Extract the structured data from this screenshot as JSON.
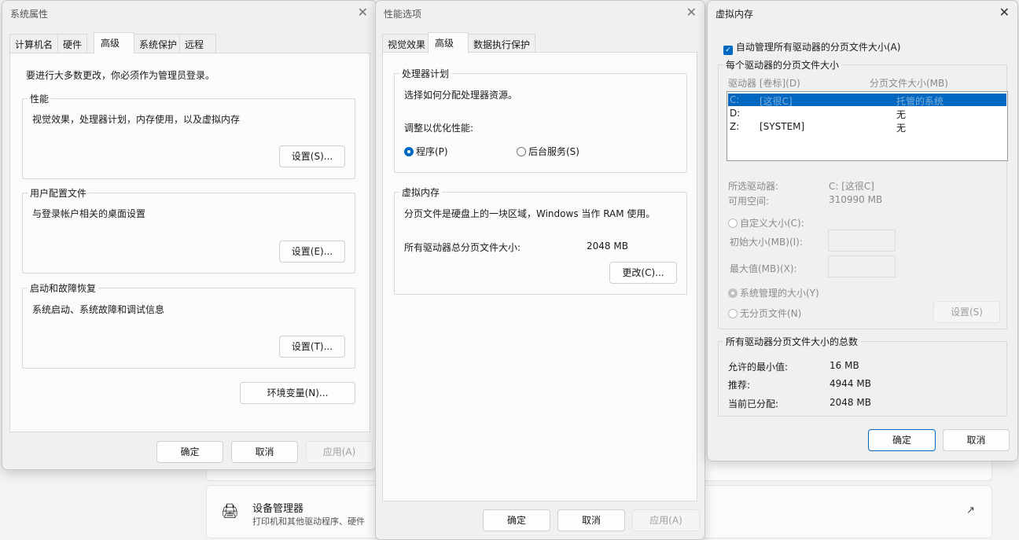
{
  "background": {
    "device_manager": {
      "title": "设备管理器",
      "subtitle": "打印机和其他驱动程序、硬件"
    }
  },
  "system_properties": {
    "title": "系统属性",
    "tabs": [
      "计算机名",
      "硬件",
      "高级",
      "系统保护",
      "远程"
    ],
    "admin_notice": "要进行大多数更改，你必须作为管理员登录。",
    "performance": {
      "label": "性能",
      "desc": "视觉效果，处理器计划，内存使用，以及虚拟内存",
      "button": "设置(S)..."
    },
    "user_profiles": {
      "label": "用户配置文件",
      "desc": "与登录帐户相关的桌面设置",
      "button": "设置(E)..."
    },
    "startup_recovery": {
      "label": "启动和故障恢复",
      "desc": "系统启动、系统故障和调试信息",
      "button": "设置(T)..."
    },
    "env_button": "环境变量(N)...",
    "ok": "确定",
    "cancel": "取消",
    "apply": "应用(A)"
  },
  "performance_options": {
    "title": "性能选项",
    "tabs": [
      "视觉效果",
      "高级",
      "数据执行保护"
    ],
    "processor": {
      "label": "处理器计划",
      "desc": "选择如何分配处理器资源。",
      "adjust": "调整以优化性能:",
      "programs": "程序(P)",
      "services": "后台服务(S)"
    },
    "virtual_memory": {
      "label": "虚拟内存",
      "desc": "分页文件是硬盘上的一块区域，Windows 当作 RAM 使用。",
      "total_label": "所有驱动器总分页文件大小:",
      "total_value": "2048 MB",
      "change": "更改(C)..."
    },
    "ok": "确定",
    "cancel": "取消",
    "apply": "应用(A)"
  },
  "virtual_memory": {
    "title": "虚拟内存",
    "auto_manage": "自动管理所有驱动器的分页文件大小(A)",
    "per_drive": {
      "label": "每个驱动器的分页文件大小",
      "col_drive": "驱动器 [卷标](D)",
      "col_size": "分页文件大小(MB)",
      "rows": [
        {
          "drive": "C:",
          "volume": "[这很C]",
          "size": "托管的系统"
        },
        {
          "drive": "D:",
          "volume": "",
          "size": "无"
        },
        {
          "drive": "Z:",
          "volume": "[SYSTEM]",
          "size": "无"
        }
      ],
      "selected_label": "所选驱动器:",
      "selected_value": "C:  [这很C]",
      "free_label": "可用空间:",
      "free_value": "310990 MB",
      "custom": "自定义大小(C):",
      "initial": "初始大小(MB)(I):",
      "max": "最大值(MB)(X):",
      "system_managed": "系统管理的大小(Y)",
      "no_paging": "无分页文件(N)",
      "set": "设置(S)"
    },
    "totals": {
      "label": "所有驱动器分页文件大小的总数",
      "min_label": "允许的最小值:",
      "min_value": "16 MB",
      "rec_label": "推荐:",
      "rec_value": "4944 MB",
      "cur_label": "当前已分配:",
      "cur_value": "2048 MB"
    },
    "ok": "确定",
    "cancel": "取消"
  }
}
